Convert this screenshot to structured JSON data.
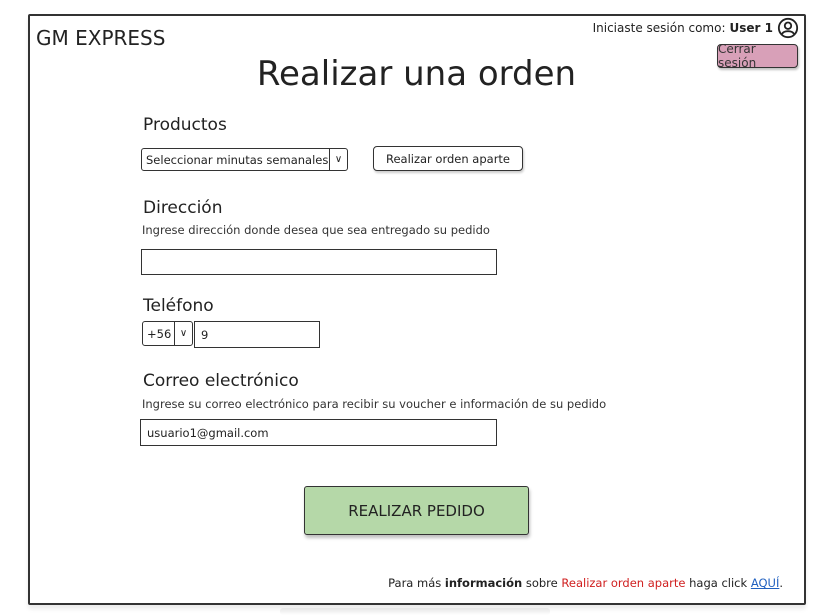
{
  "header": {
    "brand": "GM EXPRESS",
    "session_prefix": "Iniciaste sesión como:",
    "user_name": "User 1",
    "logout_label": "Cerrar sesión"
  },
  "page": {
    "title": "Realizar una orden"
  },
  "products": {
    "title": "Productos",
    "select_value": "Seleccionar minutas semanales",
    "separate_order_label": "Realizar orden aparte"
  },
  "address": {
    "title": "Dirección",
    "hint": "Ingrese dirección donde desea que sea entregado su pedido",
    "value": ""
  },
  "phone": {
    "title": "Teléfono",
    "prefix": "+56",
    "value": "9"
  },
  "email": {
    "title": "Correo electrónico",
    "hint": "Ingrese su correo electrónico para recibir su voucher e información de su pedido",
    "value": "usuario1@gmail.com"
  },
  "submit": {
    "label": "REALIZAR PEDIDO"
  },
  "footer": {
    "part1": "Para más ",
    "bold": "información",
    "part2": " sobre ",
    "red": "Realizar orden aparte",
    "part3": " haga click ",
    "link": "AQUÍ",
    "end": "."
  }
}
